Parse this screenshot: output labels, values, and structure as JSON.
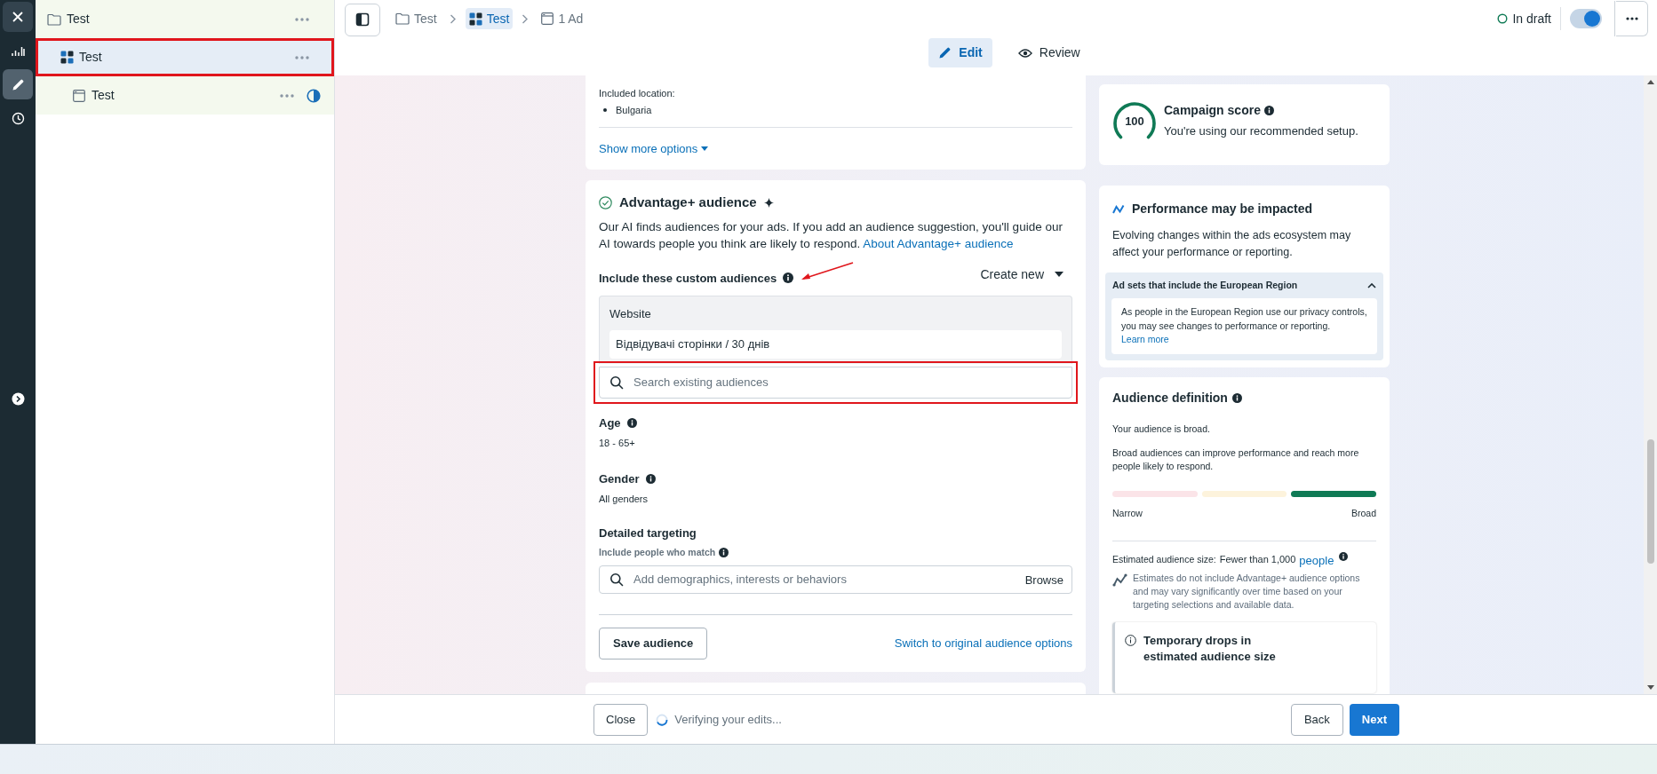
{
  "rail": [
    {
      "kind": "close",
      "selected": false
    },
    {
      "kind": "chart",
      "selected": false
    },
    {
      "kind": "edit",
      "selected": true
    },
    {
      "kind": "history",
      "selected": false
    },
    {
      "kind": "expand",
      "selected": false
    }
  ],
  "tree": [
    {
      "label": "Test",
      "kind": "campaign",
      "selected": false,
      "highlighted": false,
      "children": [
        {
          "label": "Test",
          "kind": "adset",
          "selected": true,
          "highlighted": true,
          "children": [
            {
              "label": "Test",
              "kind": "ad",
              "selected": false,
              "highlighted": false
            }
          ]
        }
      ]
    }
  ],
  "breadcrumb": [
    {
      "label": "Test",
      "kind": "campaign",
      "selected": false
    },
    {
      "label": "Test",
      "kind": "adset",
      "selected": true
    },
    {
      "label": "1 Ad",
      "kind": "ad",
      "selected": false
    }
  ],
  "draft_status": "In draft",
  "publish_toggle": {
    "on": true
  },
  "mode_tabs": [
    {
      "label": "Edit",
      "kind": "edit",
      "selected": true
    },
    {
      "label": "Review",
      "kind": "review",
      "selected": false
    }
  ],
  "locations": {
    "label": "Included location:",
    "items": [
      "Bulgaria"
    ],
    "show_more": "Show more options"
  },
  "advantage": {
    "title": "Advantage+ audience",
    "description": "Our AI finds audiences for your ads. If you add an audience suggestion, you'll guide our AI towards people you think are likely to respond.",
    "link": "About Advantage+ audience",
    "custom_audiences": {
      "label": "Include these custom audiences",
      "annotated": true,
      "create_new": "Create new",
      "group": "Website",
      "items": [
        "Відвідувачі сторінки / 30 днів"
      ],
      "search": {
        "placeholder": "Search existing audiences",
        "highlighted": true
      }
    },
    "age": {
      "label": "Age",
      "value": "18 - 65+"
    },
    "gender": {
      "label": "Gender",
      "value": "All genders"
    },
    "detailed_targeting": {
      "label": "Detailed targeting",
      "hint": "Include people who match",
      "placeholder": "Add demographics, interests or behaviors",
      "browse": "Browse"
    },
    "save_button": "Save audience",
    "switch_link": "Switch to original audience options"
  },
  "score": {
    "value": "100",
    "level": 1,
    "title": "Campaign score",
    "text": "You're using our recommended setup."
  },
  "performance": {
    "title": "Performance may be impacted",
    "text": "Evolving changes within the ads ecosystem may affect your performance or reporting.",
    "notice": {
      "title": "Ad sets that include the European Region",
      "expanded": true,
      "text": "As people in the European Region use our privacy controls, you may see changes to performance or reporting.",
      "link": "Learn more"
    }
  },
  "audience_definition": {
    "title": "Audience definition",
    "summary": "Your audience is broad.",
    "text": "Broad audiences can improve performance and reach more people likely to respond.",
    "meter_segments": [
      {
        "selected": false
      },
      {
        "selected": false
      },
      {
        "selected": true
      }
    ],
    "low_label": "Narrow",
    "high_label": "Broad",
    "estimate_label": "Estimated audience size:",
    "estimate_value": "Fewer than 1,000",
    "estimate_link": "people",
    "estimate_note": "Estimates do not include Advantage+ audience options and may vary significantly over time based on your targeting selections and available data.",
    "notice_title": "Temporary drops in estimated audience size"
  },
  "footer": {
    "close": "Close",
    "status": "Verifying your edits...",
    "back": "Back",
    "next": "Next"
  }
}
